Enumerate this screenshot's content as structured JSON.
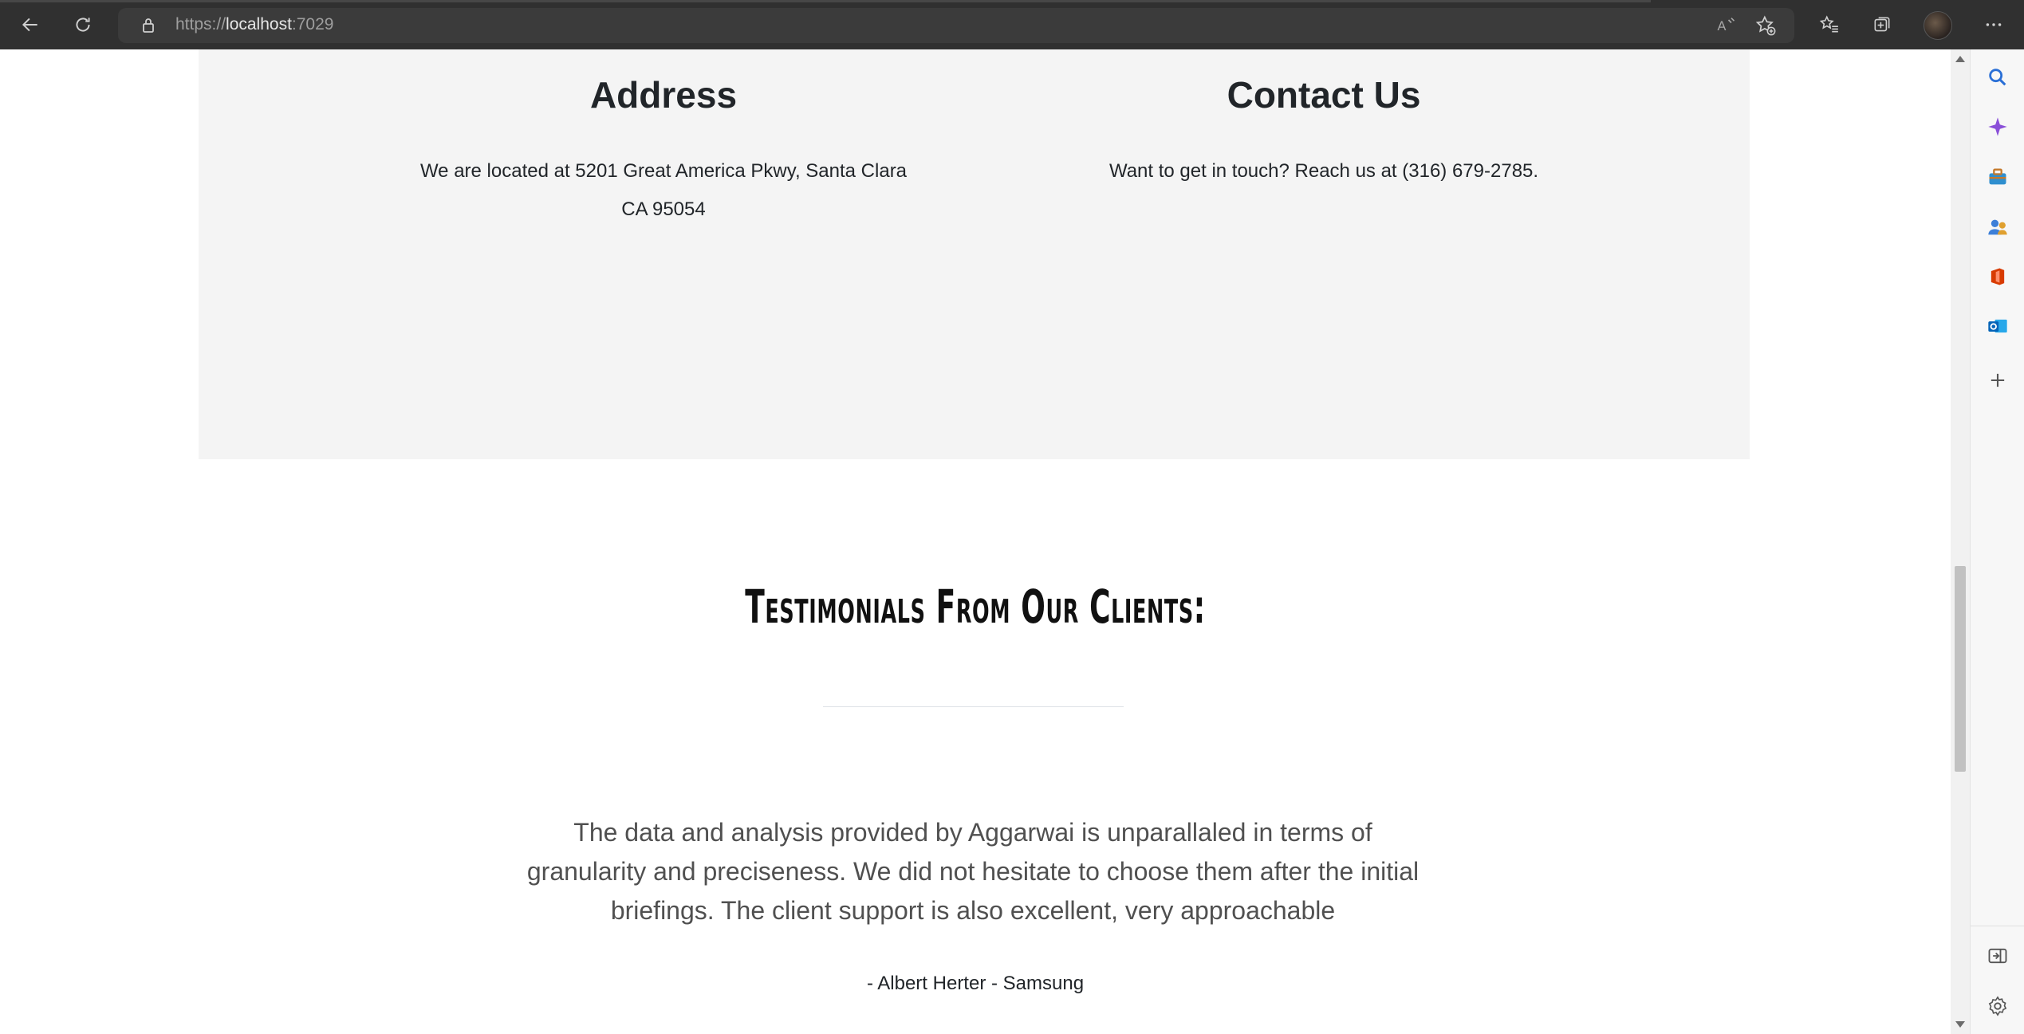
{
  "browser": {
    "url_scheme": "https://",
    "url_host": "localhost",
    "url_port": ":7029",
    "icons": [
      "back-icon",
      "refresh-icon",
      "lock-icon",
      "read-aloud-icon",
      "add-favorite-icon",
      "favorites-icon",
      "collections-icon",
      "profile-avatar",
      "more-icon"
    ]
  },
  "sidebar": {
    "icons": [
      "search-icon",
      "copilot-icon",
      "tools-icon",
      "people-icon",
      "office-icon",
      "outlook-icon",
      "add-icon",
      "split-screen-icon",
      "settings-icon"
    ]
  },
  "address_section": {
    "heading": "Address",
    "text_line1": "We are located at 5201 Great America Pkwy, Santa Clara",
    "text_line2": "CA 95054"
  },
  "contact_section": {
    "heading": "Contact Us",
    "text": "Want to get in touch? Reach us at (316) 679-2785."
  },
  "testimonials": {
    "title": "Testimonials From Our Clients:",
    "quote": "The data and analysis provided by Aggarwai is unparallaled in terms of granularity and preciseness. We did not hesitate to choose them after the initial briefings. The client support is also excellent, very approachable",
    "author": "- Albert Herter - Samsung"
  },
  "colors": {
    "chrome_bg": "#303030",
    "section_bg": "#f4f4f4",
    "text_dark": "#212529",
    "quote_text": "#505050"
  }
}
